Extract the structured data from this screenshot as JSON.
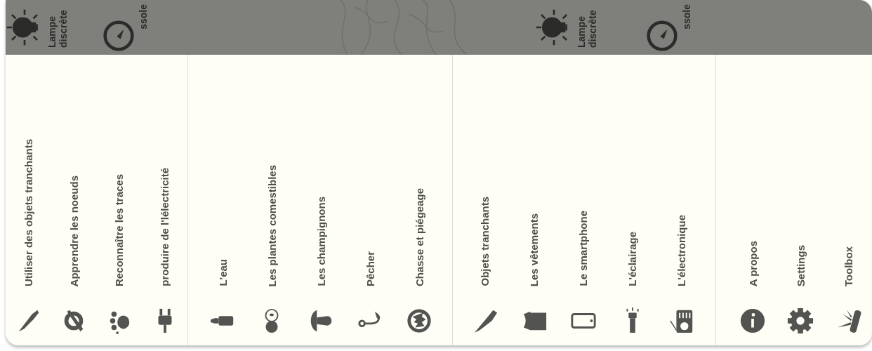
{
  "header": {
    "shortcuts": [
      {
        "label": "Lampe discrète"
      },
      {
        "label": "ssole"
      },
      {
        "label": "Lampe discrète"
      },
      {
        "label": "ssole"
      }
    ]
  },
  "sections": [
    {
      "items": [
        {
          "label": "Utiliser des objets tranchants"
        },
        {
          "label": "Apprendre les noeuds"
        },
        {
          "label": "Reconnaître les traces"
        },
        {
          "label": "produire de l'lélectricité"
        }
      ]
    },
    {
      "items": [
        {
          "label": "L'eau"
        },
        {
          "label": "Les plantes comestibles"
        },
        {
          "label": "Les champignons"
        },
        {
          "label": "Pêcher"
        },
        {
          "label": "Chasse et piégeage"
        }
      ]
    },
    {
      "items": [
        {
          "label": "Objets tranchants"
        },
        {
          "label": "Les vêtements"
        },
        {
          "label": "Le smartphone"
        },
        {
          "label": "L'éclairage"
        },
        {
          "label": "L'électronique"
        }
      ]
    },
    {
      "items": [
        {
          "label": "A propos"
        },
        {
          "label": "Settings"
        },
        {
          "label": "Toolbox"
        }
      ]
    }
  ]
}
